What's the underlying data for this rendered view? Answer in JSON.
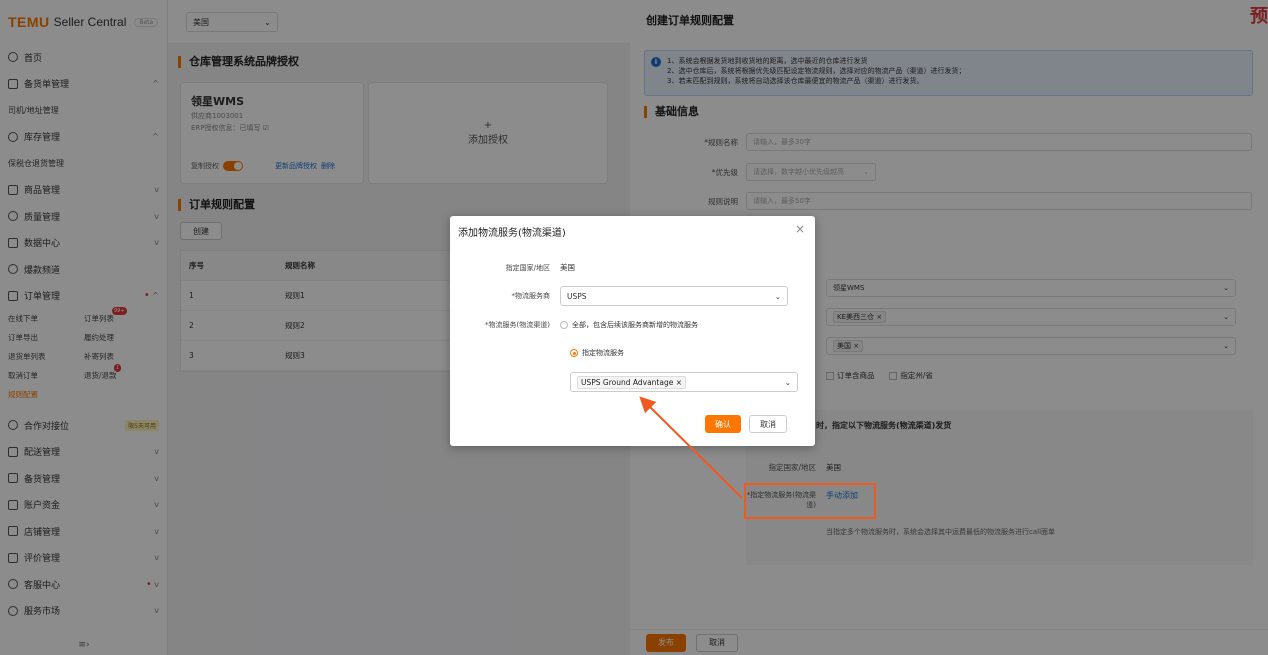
{
  "colors": {
    "accent": "#fb7701",
    "link": "#1f6fd6",
    "highlight": "#f05a22"
  },
  "brand": {
    "logo": "TEMU",
    "name": "Seller Central",
    "beta": "Beta"
  },
  "sidebar": {
    "items": [
      {
        "label": "首页",
        "icon": "home-icon",
        "chev": ""
      },
      {
        "label": "备货单管理",
        "icon": "document-icon",
        "chev": "^"
      },
      {
        "label": "司机/地址管理",
        "icon": "",
        "chev": ""
      },
      {
        "label": "库存管理",
        "icon": "warehouse-icon",
        "chev": "^"
      },
      {
        "label": "保税仓退货管理",
        "icon": "",
        "chev": ""
      },
      {
        "label": "商品管理",
        "icon": "goods-icon",
        "chev": "v"
      },
      {
        "label": "质量管理",
        "icon": "shield-icon",
        "chev": "v"
      },
      {
        "label": "数据中心",
        "icon": "chart-icon",
        "chev": "v"
      },
      {
        "label": "爆款频道",
        "icon": "fire-icon",
        "chev": ""
      },
      {
        "label": "订单管理",
        "icon": "order-icon",
        "chev": "^"
      }
    ],
    "order_sub": [
      {
        "label": "在线下单"
      },
      {
        "label": "订单列表",
        "badge": "99+"
      },
      {
        "label": "订单导出"
      },
      {
        "label": "履约处理"
      },
      {
        "label": "退货单列表"
      },
      {
        "label": "补寄列表"
      },
      {
        "label": "取消订单"
      },
      {
        "label": "退货/退款",
        "badge": "1"
      },
      {
        "label": "规则配置",
        "active": true
      }
    ],
    "bottom_items": [
      {
        "label": "合作对接位",
        "icon": "link-icon",
        "chev": "",
        "tag": "限5天可用"
      },
      {
        "label": "配送管理",
        "icon": "truck-icon",
        "chev": "v"
      },
      {
        "label": "备货管理",
        "icon": "box-icon",
        "chev": "v"
      },
      {
        "label": "账户资金",
        "icon": "wallet-icon",
        "chev": "v"
      },
      {
        "label": "店铺管理",
        "icon": "store-icon",
        "chev": "v"
      },
      {
        "label": "评价管理",
        "icon": "star-icon",
        "chev": "v"
      },
      {
        "label": "客服中心",
        "icon": "headset-icon",
        "chev": "v"
      },
      {
        "label": "服务市场",
        "icon": "market-icon",
        "chev": "v"
      }
    ],
    "collapse_glyph": "≡›"
  },
  "topbar": {
    "region": "美国"
  },
  "main": {
    "auth_title": "仓库管理系统品牌授权",
    "auth_card": {
      "name": "领星WMS",
      "sub1": "供应商1003001",
      "sub2": "ERP授权信息：已填写 ☑",
      "toggle_label": "复制授权",
      "link1": "更新品牌授权",
      "link2": "删除"
    },
    "add_auth": {
      "plus": "+",
      "label": "添加授权"
    },
    "rules_title": "订单规则配置",
    "create_btn": "创建",
    "table": {
      "headers": [
        "序号",
        "规则名称"
      ],
      "rows": [
        [
          "1",
          "规则1"
        ],
        [
          "2",
          "规则2"
        ],
        [
          "3",
          "规则3"
        ]
      ]
    }
  },
  "drawer": {
    "title": "创建订单规则配置",
    "corner": "预",
    "info": [
      "1、系统会根据发货地到收货地的距离，选中最近的仓库进行发货",
      "2、选中仓库后，系统将根据优先级匹配设定物流规则，选择对应的物流产品（渠道）进行发货；",
      "3、若未匹配到规则，系统将自动选择该仓库最便宜的物流产品（渠道）进行发货。"
    ],
    "basic_title": "基础信息",
    "fields": {
      "rule_name": {
        "label": "*规则名称",
        "placeholder": "请输入，最多30字"
      },
      "priority": {
        "label": "*优先级",
        "placeholder": "请选择，数字越小优先级越高"
      },
      "desc": {
        "label": "规则说明",
        "placeholder": "请输入，最多50字"
      }
    },
    "wms_value": "领星WMS",
    "warehouse_tag": "KE美西三仓",
    "country_tag": "美国",
    "checks": [
      "订单含商品",
      "指定州/省"
    ],
    "strategy_text": "时，指定以下物流服务(物流渠道)发货",
    "strategy_country_label": "指定国家/地区",
    "strategy_country_value": "美国",
    "strategy_service_label": "*指定物流服务(物流渠道)",
    "strategy_service_link": "手动添加",
    "strategy_note": "当指定多个物流服务时，系统会选择其中运费最低的物流服务进行call面单",
    "publish": "发布",
    "cancel": "取消"
  },
  "dialog": {
    "title": "添加物流服务(物流渠道)",
    "close": "×",
    "country_label": "指定国家/地区",
    "country_value": "美国",
    "carrier_label": "*物流服务商",
    "carrier_value": "USPS",
    "service_label": "*物流服务(物流渠道)",
    "radio_all": "全部，包含后续该服务商新增的物流服务",
    "radio_specified": "指定物流服务",
    "service_tag": "USPS Ground Advantage",
    "confirm": "确认",
    "cancel": "取消"
  }
}
